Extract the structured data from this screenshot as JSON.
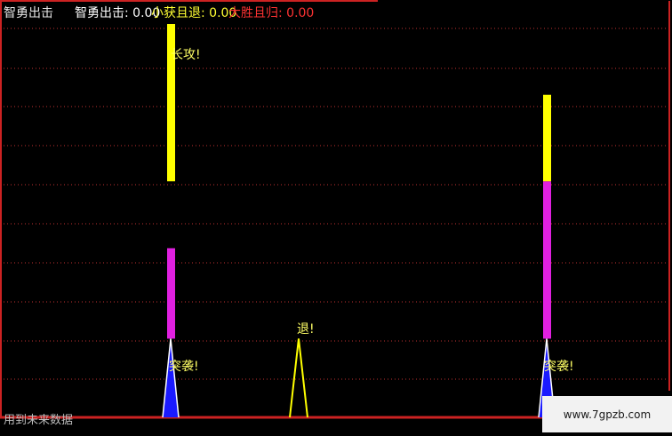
{
  "header": {
    "title": "智勇出击",
    "legend": [
      {
        "name": "智勇出击",
        "value": "0.00",
        "color": "#ffffff"
      },
      {
        "name": "小获且退",
        "value": "0.00",
        "color": "#ffff33"
      },
      {
        "name": "大胜且归",
        "value": "0.00",
        "color": "#ff3333"
      }
    ]
  },
  "footer_text": "用到未来数据",
  "watermark": "www.7gpzb.com",
  "colors": {
    "grid": "#c03030",
    "axis": "#cc2222",
    "yellow": "#ffff00",
    "magenta": "#e020e0",
    "blue": "#1a1aff",
    "white": "#ffffff",
    "label": "#ffff66"
  },
  "chart_data": {
    "type": "bar",
    "grid": "horizontal dotted",
    "bars": [
      {
        "id": "bar-1-magenta",
        "segments": [
          {
            "color": "magenta",
            "from": 0.2,
            "to": 0.43
          }
        ]
      },
      {
        "id": "bar-1-yellow",
        "segments": [
          {
            "color": "yellow",
            "from": 0.6,
            "to": 1.0
          }
        ]
      },
      {
        "id": "bar-2",
        "segments": [
          {
            "color": "magenta",
            "from": 0.2,
            "to": 0.6
          },
          {
            "color": "yellow",
            "from": 0.6,
            "to": 0.82
          }
        ]
      }
    ],
    "markers": [
      {
        "id": "spike-1",
        "type": "blue-white spike",
        "height": 0.2
      },
      {
        "id": "spike-2",
        "type": "yellow spike",
        "height": 0.2
      },
      {
        "id": "spike-3",
        "type": "blue-white spike",
        "height": 0.2
      }
    ],
    "annotations": [
      {
        "id": "label-1",
        "text": "长攻!"
      },
      {
        "id": "label-2",
        "text": "突袭!"
      },
      {
        "id": "label-3",
        "text": "退!"
      },
      {
        "id": "label-4",
        "text": "突袭!"
      }
    ]
  }
}
